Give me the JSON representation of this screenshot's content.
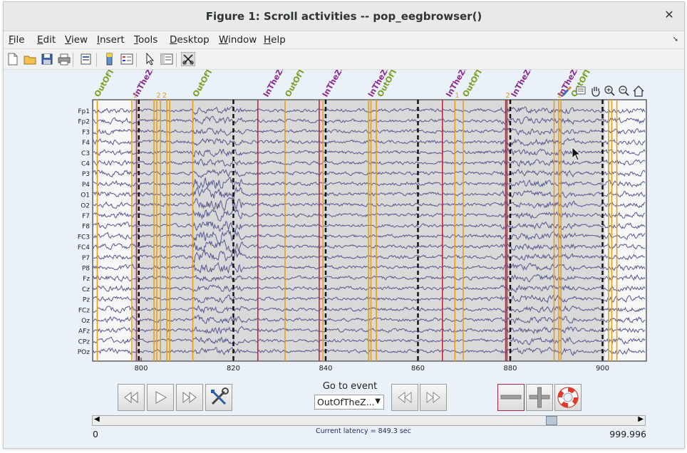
{
  "window": {
    "title": "Figure 1: Scroll activities -- pop_eegbrowser()",
    "close_icon": "close-icon"
  },
  "menubar": {
    "items": [
      {
        "label": "File",
        "ul": "F",
        "rest": "ile"
      },
      {
        "label": "Edit",
        "ul": "E",
        "rest": "dit"
      },
      {
        "label": "View",
        "ul": "V",
        "rest": "iew"
      },
      {
        "label": "Insert",
        "ul": "I",
        "rest": "nsert"
      },
      {
        "label": "Tools",
        "ul": "T",
        "rest": "ools"
      },
      {
        "label": "Desktop",
        "ul": "D",
        "rest": "esktop"
      },
      {
        "label": "Window",
        "ul": "W",
        "rest": "indow"
      },
      {
        "label": "Help",
        "ul": "H",
        "rest": "elp"
      }
    ],
    "dock_icon": "dock-arrow-icon"
  },
  "toolbar": {
    "icons": [
      "new-figure-icon",
      "open-file-icon",
      "save-icon",
      "print-icon",
      "print-preview-icon",
      "colorbar-icon",
      "legend-icon",
      "select-arrow-icon",
      "property-editor-icon",
      "scissors-icon"
    ]
  },
  "axes_toolbar": {
    "icons": [
      "brush-icon",
      "datatip-icon",
      "pan-hand-icon",
      "zoom-in-icon",
      "zoom-out-icon",
      "home-icon"
    ]
  },
  "plot": {
    "channels": [
      "Fp1",
      "Fp2",
      "F3",
      "F4",
      "C3",
      "C4",
      "P3",
      "P4",
      "O1",
      "O2",
      "F7",
      "F8",
      "FC3",
      "FC4",
      "P7",
      "P8",
      "Fz",
      "Cz",
      "Pz",
      "FCz",
      "Oz",
      "AFz",
      "CPz",
      "POz"
    ],
    "x_ticks": [
      "800",
      "820",
      "840",
      "860",
      "880",
      "900"
    ],
    "x_tick_values": [
      800,
      820,
      840,
      860,
      880,
      900
    ],
    "x_range": [
      789.5,
      909.5
    ],
    "event_labels": [
      {
        "text": "OutOfTh",
        "type": "out",
        "t": 790.2
      },
      {
        "text": "InTheZo",
        "type": "in",
        "t": 798.6
      },
      {
        "text": "OutOfTh",
        "type": "out",
        "t": 811.5
      },
      {
        "text": "InTheZo",
        "type": "in",
        "t": 826.8
      },
      {
        "text": "OutOfTh",
        "type": "out",
        "t": 831.5
      },
      {
        "text": "InTheZo",
        "type": "in",
        "t": 839.6
      },
      {
        "text": "InTheZo",
        "type": "in",
        "t": 849.5
      },
      {
        "text": "OutOfTh",
        "type": "out",
        "t": 851.5
      },
      {
        "text": "InTheZo",
        "type": "in",
        "t": 866.4
      },
      {
        "text": "OutOfTh",
        "type": "out",
        "t": 870.0
      },
      {
        "text": "InTheZo",
        "type": "in",
        "t": 880.5
      },
      {
        "text": "InTheZo",
        "type": "in",
        "t": 890.6
      },
      {
        "text": "OutOfTh",
        "type": "out",
        "t": 893.5
      }
    ],
    "small_event_marks": [
      "1",
      "2",
      "2",
      "1",
      "2",
      "2"
    ],
    "colors": {
      "trace": "#56578f",
      "in_event": "#8b2a8c",
      "out_event": "#79a021",
      "orange_line": "#e5a019",
      "red_line": "#c0283f",
      "boundary": "#111111",
      "plot_bg": "#d9d9d9",
      "figure_bg": "#eaf1f8"
    }
  },
  "controls": {
    "goto_label": "Go to event",
    "event_selected": "OutOfTheZ...",
    "nav_icons": [
      "fast-rewind-icon",
      "play-icon",
      "fast-forward-icon",
      "settings-wrench-icon"
    ],
    "event_nav_icons": [
      "previous-event-icon",
      "next-event-icon"
    ],
    "scale_icons": [
      "decrease-scale-icon",
      "increase-scale-icon",
      "help-lifebuoy-icon"
    ],
    "scroll_left_icon": "scroll-left-arrow-icon",
    "scroll_right_icon": "scroll-right-arrow-icon",
    "slider_min": "0",
    "slider_max": "999.996",
    "latency_text": "Current latency = 849.3 sec",
    "slider_position": 0.849
  }
}
